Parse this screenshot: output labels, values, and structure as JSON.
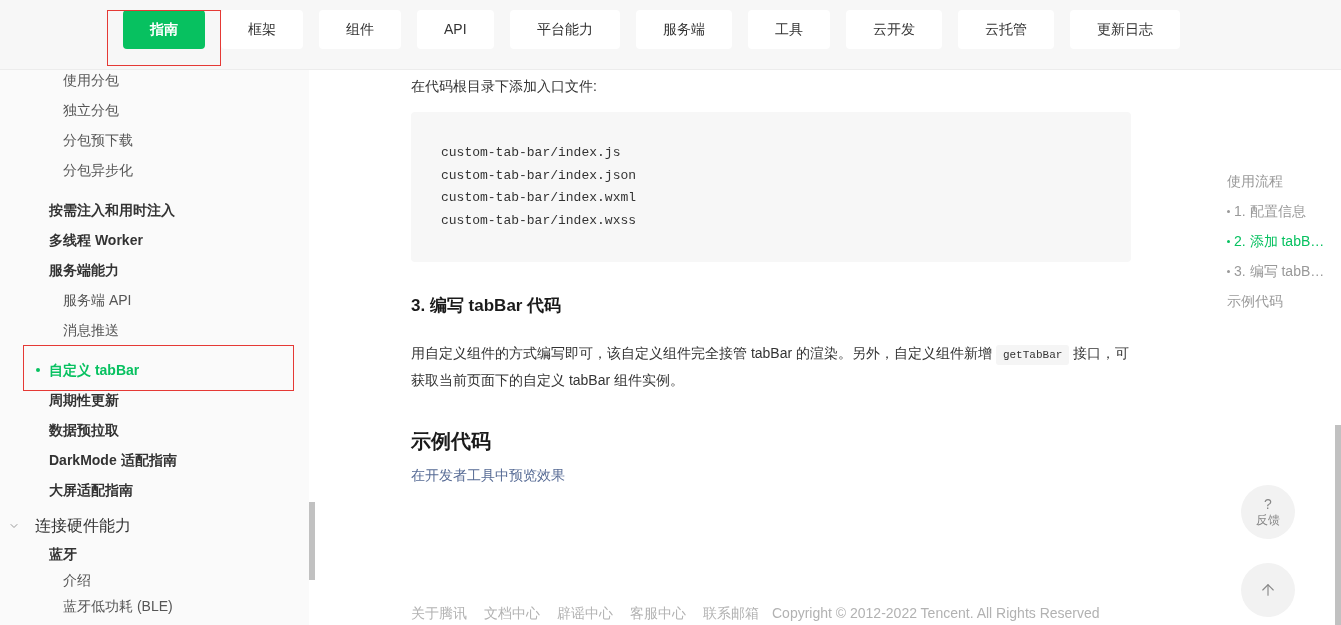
{
  "nav": {
    "tabs": [
      {
        "label": "指南",
        "selected": true,
        "highlighted": true
      },
      {
        "label": "框架",
        "selected": false
      },
      {
        "label": "组件",
        "selected": false
      },
      {
        "label": "API",
        "selected": false
      },
      {
        "label": "平台能力",
        "selected": false
      },
      {
        "label": "服务端",
        "selected": false
      },
      {
        "label": "工具",
        "selected": false
      },
      {
        "label": "云开发",
        "selected": false
      },
      {
        "label": "云托管",
        "selected": false
      },
      {
        "label": "更新日志",
        "selected": false
      }
    ]
  },
  "sidebar": {
    "sections": [
      {
        "items": [
          {
            "children": [
              {
                "label": "使用分包",
                "selected": false
              },
              {
                "label": "独立分包",
                "selected": false
              },
              {
                "label": "分包预下载",
                "selected": false
              },
              {
                "label": "分包异步化",
                "selected": false
              }
            ]
          },
          {
            "label": "按需注入和用时注入",
            "selected": false
          },
          {
            "label": "多线程 Worker",
            "selected": false
          },
          {
            "label": "服务端能力",
            "selected": false,
            "children": [
              {
                "label": "服务端 API",
                "selected": false
              },
              {
                "label": "消息推送",
                "selected": false
              }
            ]
          },
          {
            "label": "自定义 tabBar",
            "selected": true,
            "highlighted": true
          },
          {
            "label": "周期性更新",
            "selected": false
          },
          {
            "label": "数据预拉取",
            "selected": false
          },
          {
            "label": "DarkMode 适配指南",
            "selected": false
          },
          {
            "label": "大屏适配指南",
            "selected": false
          }
        ]
      },
      {
        "label": "连接硬件能力",
        "expanded": true,
        "items": [
          {
            "label": "蓝牙",
            "selected": false,
            "children": [
              {
                "label": "介绍",
                "selected": false
              },
              {
                "label": "蓝牙低功耗 (BLE)",
                "selected": false
              }
            ]
          }
        ]
      }
    ]
  },
  "content": {
    "intro": "在代码根目录下添加入口文件:",
    "code_block": {
      "lines": [
        "custom-tab-bar/index.js",
        "custom-tab-bar/index.json",
        "custom-tab-bar/index.wxml",
        "custom-tab-bar/index.wxss"
      ]
    },
    "heading": "3. 编写 tabBar 代码",
    "paragraph": [
      {
        "kind": "text",
        "text": "用自定义组件的方式编写即可，该自定义组件完全接管 tabBar 的渲染。另外，自定义组件新增 "
      },
      {
        "kind": "code",
        "text": "getTabBar"
      },
      {
        "kind": "text",
        "text": " 接口，可获取当前页面下的自定义 tabBar 组件实例。"
      }
    ],
    "section_title": "示例代码",
    "link": "在开发者工具中预览效果"
  },
  "footer": {
    "links": [
      "关于腾讯",
      "文档中心",
      "辟谣中心",
      "客服中心",
      "联系邮箱"
    ],
    "copyright": "Copyright © 2012-2022 Tencent. All Rights Reserved"
  },
  "toc": {
    "items": [
      {
        "label": "使用流程",
        "selected": false,
        "children": [
          {
            "label": "1. 配置信息",
            "selected": false
          },
          {
            "label": "2. 添加 tabB…",
            "selected": true
          },
          {
            "label": "3. 编写 tabB…",
            "selected": false
          }
        ]
      },
      {
        "label": "示例代码",
        "selected": false
      }
    ]
  },
  "floating": {
    "feedback": {
      "symbol": "?",
      "label": "反馈"
    }
  }
}
